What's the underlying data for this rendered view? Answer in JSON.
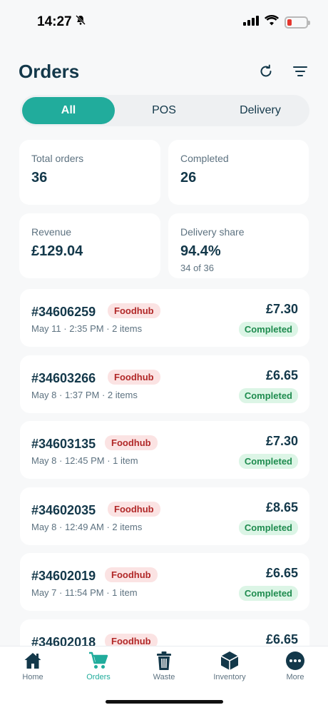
{
  "status_bar": {
    "time": "14:27"
  },
  "header": {
    "title": "Orders"
  },
  "segments": [
    "All",
    "POS",
    "Delivery"
  ],
  "stats": {
    "total_orders": {
      "label": "Total orders",
      "value": "36"
    },
    "completed": {
      "label": "Completed",
      "value": "26"
    },
    "revenue": {
      "label": "Revenue",
      "value": "£129.04"
    },
    "delivery_share": {
      "label": "Delivery share",
      "value": "94.4%",
      "sub": "34 of 36"
    }
  },
  "orders": [
    {
      "id": "#34606259",
      "source": "Foodhub",
      "meta": "May 11 · 2:35 PM · 2 items",
      "amount": "£7.30",
      "status": "Completed"
    },
    {
      "id": "#34603266",
      "source": "Foodhub",
      "meta": "May 8 · 1:37 PM · 2 items",
      "amount": "£6.65",
      "status": "Completed"
    },
    {
      "id": "#34603135",
      "source": "Foodhub",
      "meta": "May 8 · 12:45 PM · 1 item",
      "amount": "£7.30",
      "status": "Completed"
    },
    {
      "id": "#34602035",
      "source": "Foodhub",
      "meta": "May 8 · 12:49 AM · 2 items",
      "amount": "£8.65",
      "status": "Completed"
    },
    {
      "id": "#34602019",
      "source": "Foodhub",
      "meta": "May 7 · 11:54 PM · 1 item",
      "amount": "£6.65",
      "status": "Completed"
    },
    {
      "id": "#34602018",
      "source": "Foodhub",
      "meta": "",
      "amount": "£6.65",
      "status": ""
    }
  ],
  "tabs": [
    {
      "label": "Home",
      "icon": "home-icon"
    },
    {
      "label": "Orders",
      "icon": "cart-icon"
    },
    {
      "label": "Waste",
      "icon": "trash-icon"
    },
    {
      "label": "Inventory",
      "icon": "box-icon"
    },
    {
      "label": "More",
      "icon": "more-icon"
    }
  ],
  "colors": {
    "accent": "#21ac9c",
    "title": "#13384a",
    "badge_bg": "#fbe3e3",
    "badge_text": "#b12828",
    "status_bg": "#dcf5e6",
    "status_text": "#1f8c4f"
  }
}
